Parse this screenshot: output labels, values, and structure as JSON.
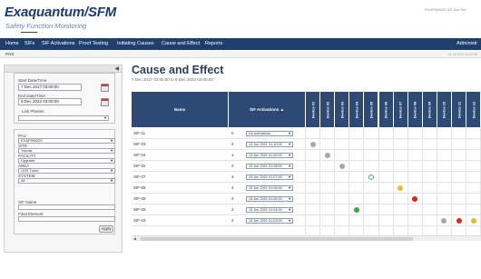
{
  "header": {
    "brand": "Exaquantum/SFM",
    "subtitle": "Safety Function Monitoring",
    "server_text": "EXAPHM220-3/2 Exa Ser"
  },
  "nav": {
    "items": [
      "Home",
      "SIFs",
      "SIF Activations",
      "Proof Testing",
      "Initiating Causes",
      "Cause and Effect",
      "Reports"
    ],
    "user": "Administr"
  },
  "subbar": {
    "print": "Print",
    "right_text": "13 Jul 2021 10:12:08"
  },
  "sidebar": {
    "collapse_icon": "chevron-left-icon",
    "start_label": "Start Date/Time",
    "start_value": "7 Dec 2017 03:00:00",
    "end_label": "End Date/Time",
    "end_value": "8 Dec 2022 03:00:00",
    "link_phases_label": "Link Phases",
    "filters": [
      {
        "label": "PAU",
        "value": "EXAPHM220"
      },
      {
        "label": "SITE",
        "value": "Yokota"
      },
      {
        "label": "FACILITY",
        "value": "Upgrade"
      },
      {
        "label": "AREA",
        "value": "OSS Tuner"
      },
      {
        "label": "SYSTEM",
        "value": "All"
      }
    ],
    "sif_name_label": "SIF Name",
    "final_element_label": "Final Element",
    "apply_label": "Apply"
  },
  "main": {
    "title": "Cause and Effect",
    "date_range": "7 Dec 2017 03:00:00 to 8 Dec 2022 03:00:00"
  },
  "table": {
    "headers": {
      "name": "Name",
      "activations": "SIF Activations",
      "sort_icon": "sort-up-icon",
      "devices": [
        "Device 01",
        "Device 02",
        "Device 03",
        "Device 04",
        "Device 05",
        "Device 06",
        "Device 07",
        "Device 08",
        "Device 09",
        "Device 10",
        "Device 11",
        "Device 12"
      ]
    },
    "rows": [
      {
        "name": "SIF-11",
        "count": "0",
        "select": "No activations"
      },
      {
        "name": "SIF-03",
        "count": "2",
        "select": "13 Jun 2021 01:10:00"
      },
      {
        "name": "SIF-04",
        "count": "1",
        "select": "13 Jun 2021 01:09:00"
      },
      {
        "name": "SIF-02",
        "count": "2",
        "select": "13 Jun 2021 01:08:00"
      },
      {
        "name": "SIF-07",
        "count": "3",
        "select": "13 Jun 2021 01:07:00"
      },
      {
        "name": "SIF-08",
        "count": "4",
        "select": "13 Jun 2021 01:06:00"
      },
      {
        "name": "SIF-09",
        "count": "2",
        "select": "13 Jun 2021 01:05:00"
      },
      {
        "name": "SIF-05",
        "count": "2",
        "select": "13 Jun 2021 01:04:00"
      },
      {
        "name": "SIF-15",
        "count": "2",
        "select": "13 Jun 2021 01:03:00"
      }
    ],
    "dots": [
      {
        "row": 1,
        "device": 0,
        "color": "#a7a7a7",
        "hollow": false
      },
      {
        "row": 2,
        "device": 1,
        "color": "#a7a7a7",
        "hollow": false
      },
      {
        "row": 3,
        "device": 2,
        "color": "#a7a7a7",
        "hollow": false
      },
      {
        "row": 4,
        "device": 4,
        "color": "#4caf50",
        "hollow": true
      },
      {
        "row": 5,
        "device": 6,
        "color": "#e5b92b",
        "hollow": false
      },
      {
        "row": 6,
        "device": 7,
        "color": "#e0251d",
        "hollow": false
      },
      {
        "row": 7,
        "device": 3,
        "color": "#3ca743",
        "hollow": false
      },
      {
        "row": 8,
        "device": 9,
        "color": "#a7a7a7",
        "hollow": false
      },
      {
        "row": 8,
        "device": 10,
        "color": "#e0251d",
        "hollow": false
      },
      {
        "row": 8,
        "device": 11,
        "color": "#e5b92b",
        "hollow": false
      }
    ]
  },
  "colors": {
    "navbar": "#1f3f6e",
    "header_row": "#2c4a74",
    "brand": "#1c3b6f"
  }
}
